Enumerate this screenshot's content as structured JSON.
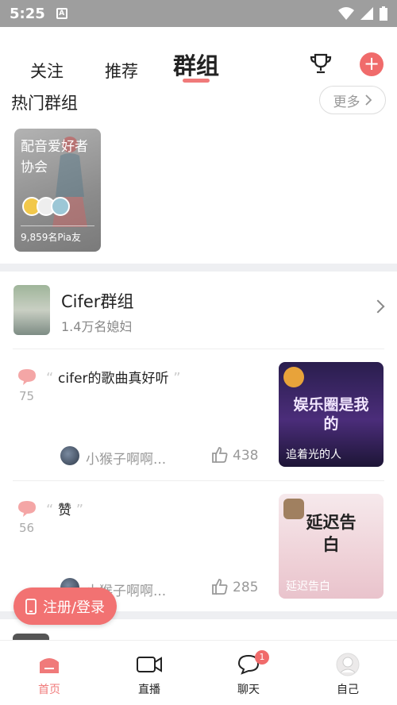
{
  "status_bar": {
    "time": "5:25",
    "notification_letter": "A"
  },
  "header": {
    "tabs": [
      {
        "label": "关注"
      },
      {
        "label": "推荐"
      },
      {
        "label": "群组",
        "active": true
      }
    ],
    "trophy_icon": "trophy-icon",
    "add_icon": "plus-icon"
  },
  "hot_groups": {
    "title": "热门群组",
    "more_label": "更多",
    "cards": [
      {
        "title": "配音爱好者协会",
        "members": "9,859名Pia友"
      }
    ]
  },
  "group": {
    "name": "Cifer群组",
    "members": "1.4万名媳妇",
    "posts": [
      {
        "comment_count": "75",
        "text": "cifer的歌曲真好听",
        "author": "小猴子啊啊...",
        "likes": "438",
        "thumb_caption": "追着光的人",
        "thumb_art": "娱乐圈是我的",
        "thumb_color": "#3a2a6a"
      },
      {
        "comment_count": "56",
        "text": "赞",
        "author": "小猴子啊啊...",
        "likes": "285",
        "thumb_caption": "延迟告白",
        "thumb_art": "延迟告白",
        "thumb_color": "#f1dfe3"
      }
    ]
  },
  "register_button": {
    "label": "注册/登录"
  },
  "bottom_nav": [
    {
      "label": "首页",
      "icon": "home-icon",
      "active": true
    },
    {
      "label": "直播",
      "icon": "live-camera-icon"
    },
    {
      "label": "聊天",
      "icon": "chat-bubble-icon",
      "badge": "1"
    },
    {
      "label": "自己",
      "icon": "profile-avatar-icon"
    }
  ],
  "colors": {
    "accent": "#f07a7a",
    "section_gap": "#eeeff2"
  }
}
